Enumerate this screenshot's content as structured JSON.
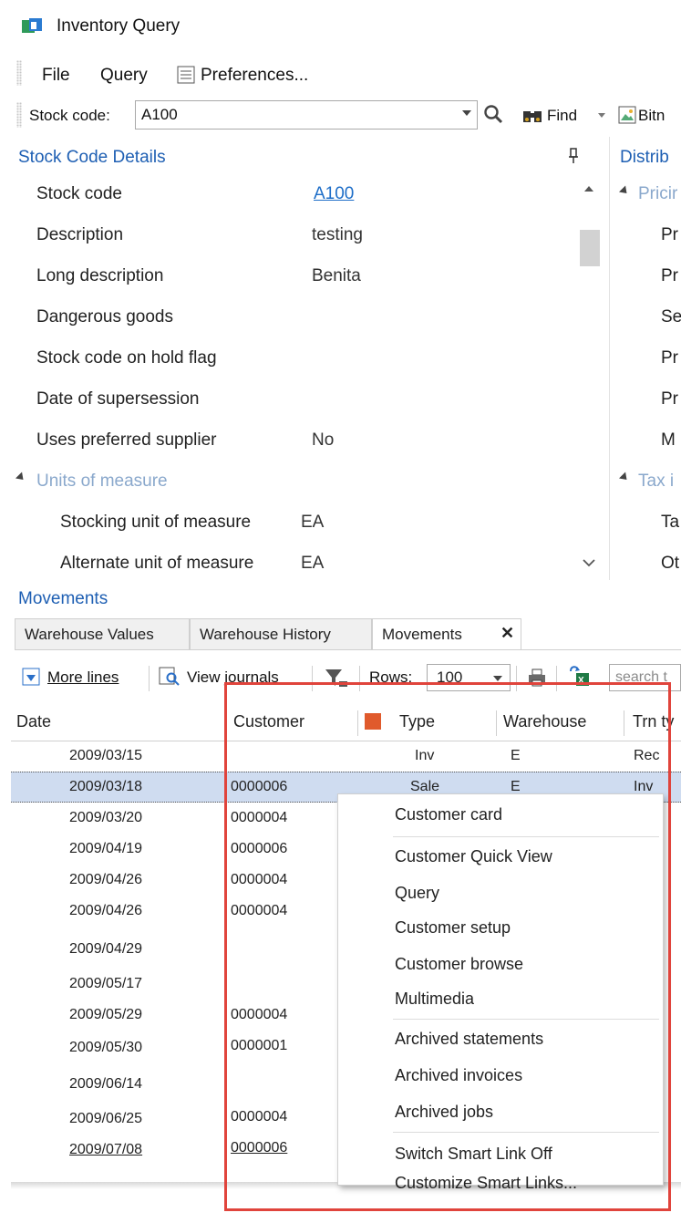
{
  "window": {
    "title": "Inventory Query"
  },
  "menu": {
    "file": "File",
    "query": "Query",
    "preferences": "Preferences..."
  },
  "toolbar": {
    "stock_code_label": "Stock code:",
    "stock_code_value": "A100",
    "find_label": "Find",
    "bitmap_label": "Bitn"
  },
  "details": {
    "title": "Stock Code Details",
    "rows": [
      {
        "label": "Stock code",
        "value": "A100"
      },
      {
        "label": "Description",
        "value": "testing"
      },
      {
        "label": "Long description",
        "value": "Benita"
      },
      {
        "label": "Dangerous goods",
        "value": ""
      },
      {
        "label": "Stock code on hold flag",
        "value": ""
      },
      {
        "label": "Date of supersession",
        "value": ""
      },
      {
        "label": "Uses preferred supplier",
        "value": "No"
      }
    ],
    "group": "Units of measure",
    "uom_rows": [
      {
        "label": "Stocking unit of measure",
        "value": "EA"
      },
      {
        "label": "Alternate unit of measure",
        "value": "EA"
      }
    ]
  },
  "distribution": {
    "title": "Distrib",
    "group1": "Pricir",
    "items1": [
      "Pr",
      "Pr",
      "Se",
      "Pr",
      "Pr",
      "M"
    ],
    "group2": "Tax i",
    "items2": [
      "Ta",
      "Ot"
    ]
  },
  "movements": {
    "title": "Movements",
    "tabs": [
      "Warehouse Values",
      "Warehouse History",
      "Movements"
    ],
    "toolbar": {
      "more_lines": "More lines",
      "view_journals": "View journals",
      "rows_label": "Rows:",
      "rows_value": "100",
      "search_placeholder": "search t"
    },
    "columns": [
      "Date",
      "Customer",
      "Type",
      "Warehouse",
      "Trn ty"
    ],
    "rows": [
      {
        "date": "2009/03/15",
        "customer": "",
        "type": "Inv",
        "warehouse": "E",
        "trn": "Rec"
      },
      {
        "date": "2009/03/18",
        "customer": "0000006",
        "type": "Sale",
        "warehouse": "E",
        "trn": "Inv"
      },
      {
        "date": "2009/03/20",
        "customer": "0000004",
        "type": "",
        "warehouse": "",
        "trn": ""
      },
      {
        "date": "2009/04/19",
        "customer": "0000006",
        "type": "",
        "warehouse": "",
        "trn": ""
      },
      {
        "date": "2009/04/26",
        "customer": "0000004",
        "type": "",
        "warehouse": "",
        "trn": ""
      },
      {
        "date": "2009/04/26",
        "customer": "0000004",
        "type": "",
        "warehouse": "",
        "trn": ""
      },
      {
        "date": "2009/04/29",
        "customer": "",
        "type": "",
        "warehouse": "",
        "trn": ""
      },
      {
        "date": "2009/05/17",
        "customer": "",
        "type": "",
        "warehouse": "",
        "trn": ""
      },
      {
        "date": "2009/05/29",
        "customer": "0000004",
        "type": "",
        "warehouse": "",
        "trn": ""
      },
      {
        "date": "2009/05/30",
        "customer": "0000001",
        "type": "",
        "warehouse": "",
        "trn": ""
      },
      {
        "date": "2009/06/14",
        "customer": "",
        "type": "",
        "warehouse": "",
        "trn": ""
      },
      {
        "date": "2009/06/25",
        "customer": "0000004",
        "type": "",
        "warehouse": "",
        "trn": ""
      },
      {
        "date": "2009/07/08",
        "customer": "0000006",
        "type": "",
        "warehouse": "",
        "trn": ""
      }
    ]
  },
  "context_menu": {
    "items": [
      "Customer card",
      "Customer Quick View",
      "Query",
      "Customer setup",
      "Customer browse",
      "Multimedia",
      "Archived statements",
      "Archived invoices",
      "Archived jobs",
      "Switch Smart Link Off",
      "Customize Smart Links..."
    ]
  },
  "colors": {
    "accent": "#1e5fb3",
    "highlight_box": "#e0443c",
    "selected_row": "#cfdcf0"
  }
}
